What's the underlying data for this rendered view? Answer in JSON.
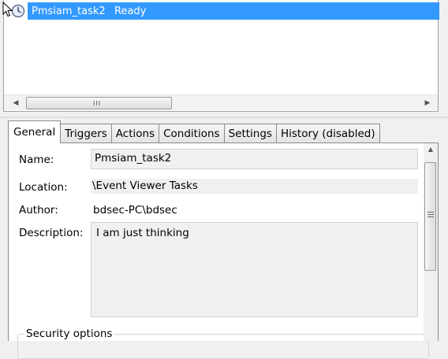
{
  "task_list": {
    "rows": [
      {
        "name": "Pmsiam_task2",
        "status": "Ready",
        "selected": true
      }
    ],
    "hscroll_grip": "III"
  },
  "tabs": [
    {
      "label": "General",
      "active": true
    },
    {
      "label": "Triggers",
      "active": false
    },
    {
      "label": "Actions",
      "active": false
    },
    {
      "label": "Conditions",
      "active": false
    },
    {
      "label": "Settings",
      "active": false
    },
    {
      "label": "History (disabled)",
      "active": false
    }
  ],
  "general": {
    "name_label": "Name:",
    "name_value": "Pmsiam_task2",
    "location_label": "Location:",
    "location_value": "\\Event Viewer Tasks",
    "author_label": "Author:",
    "author_value": "bdsec-PC\\bdsec",
    "description_label": "Description:",
    "description_value": "I am just thinking",
    "security_legend": "Security options"
  },
  "colors": {
    "selection": "#3399ff",
    "panel_bg": "#ffffff",
    "window_bg": "#f0f0f0"
  },
  "icons": {
    "row_icon": "clock-icon",
    "cursor": "mouse-pointer-icon"
  }
}
